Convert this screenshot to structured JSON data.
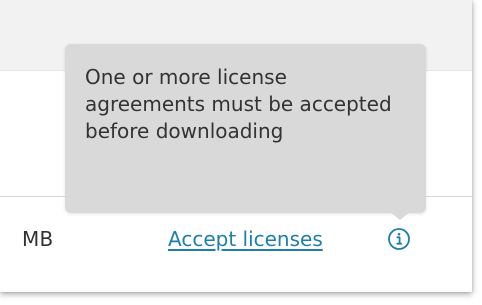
{
  "row": {
    "size_text": "MB",
    "accept_link_label": "Accept licenses"
  },
  "tooltip": {
    "text": "One or more license agreements must be accepted before downloading"
  },
  "icons": {
    "info": "info-icon"
  },
  "colors": {
    "link": "#1f7fa8",
    "tooltip_background": "#d9d9d9",
    "header_background": "#f2f2f2"
  }
}
